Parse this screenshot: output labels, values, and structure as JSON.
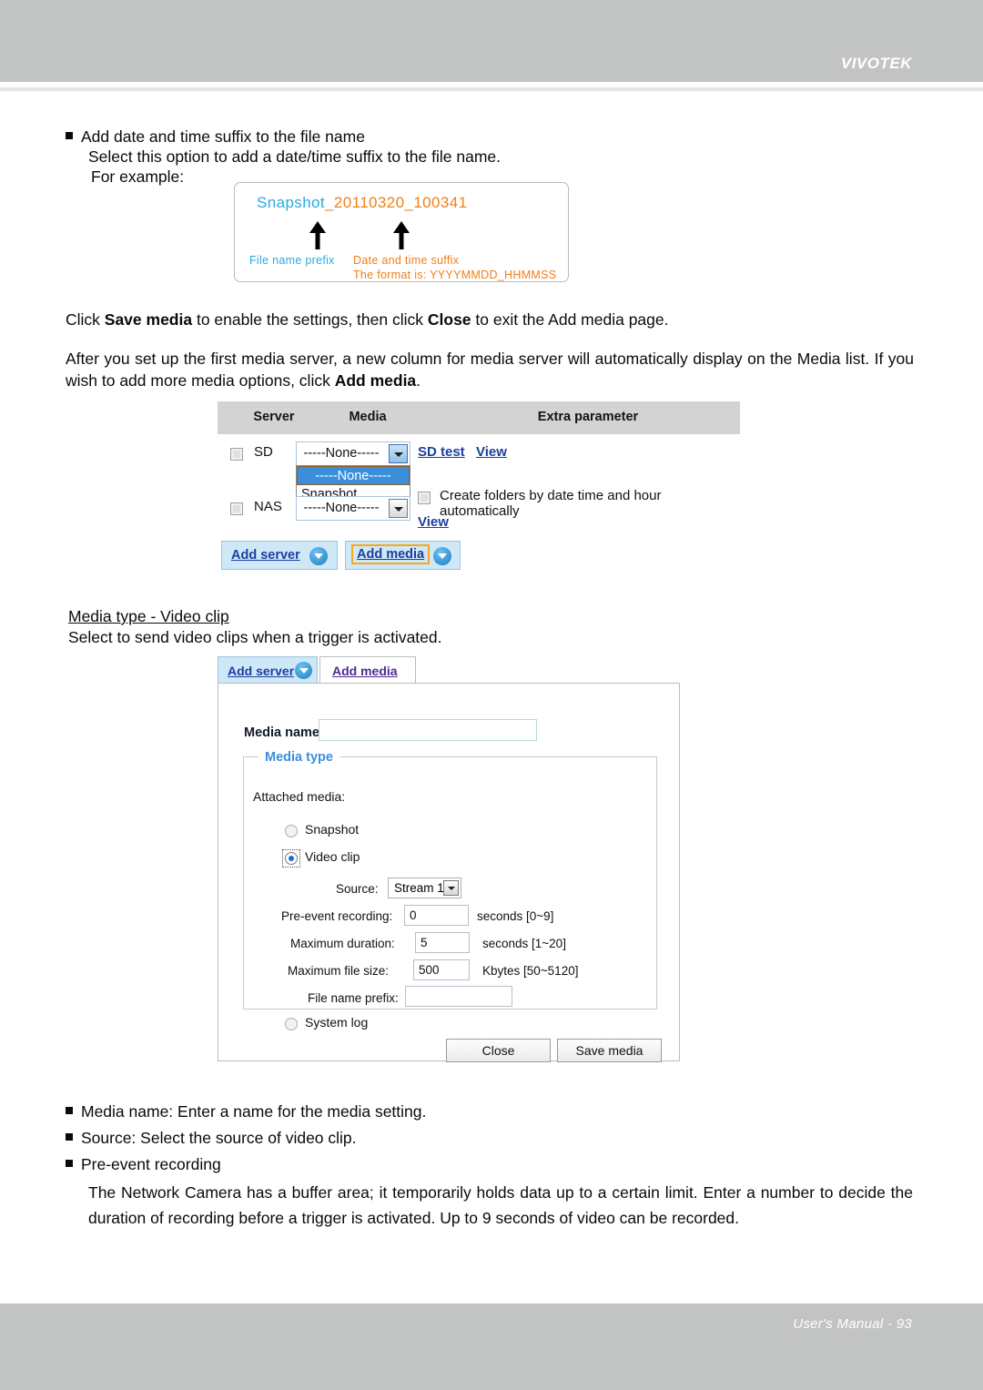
{
  "header": {
    "brand": "VIVOTEK"
  },
  "footer": {
    "text": "User's Manual - 93"
  },
  "section_suffix": {
    "bullet_title": "Add date and time suffix to the file name",
    "line1": "Select this option to add a date/time suffix to the file name.",
    "line2": "For example:"
  },
  "snapshot_example": {
    "prefix": "Snapshot",
    "suffix": "_20110320_100341",
    "label_prefix": "File name prefix",
    "label_suffix": "Date and time suffix",
    "label_format": "The format is: YYYYMMDD_HHMMSS",
    "color_blue": "#2aa9e0",
    "color_orange": "#f07f18"
  },
  "para_save": {
    "a": "Click ",
    "b1": "Save media",
    "c": " to enable the settings, then click ",
    "b2": "Close",
    "d": " to exit the Add media page."
  },
  "para_after": {
    "a": "After you set up the first media server, a new column for media server will automatically display on the Media list. If you wish to add more media options, click ",
    "b": "Add media",
    "c": "."
  },
  "media_list": {
    "columns": [
      "Server",
      "Media",
      "Extra parameter"
    ],
    "rows": [
      {
        "name": "SD",
        "checked": false,
        "media_value": "-----None-----",
        "links": [
          "SD test",
          "View"
        ],
        "extra_checkbox": "Create folders by date time and hour automatically",
        "extra_checked": false
      },
      {
        "name": "NAS",
        "checked": false,
        "media_value": "-----None-----",
        "links": [
          "View"
        ]
      }
    ],
    "dropdown_options": [
      "-----None-----",
      "Snapshot"
    ],
    "dropdown_selected": "-----None-----",
    "buttons": [
      {
        "label": "Add server",
        "highlighted": false
      },
      {
        "label": "Add media",
        "highlighted": true
      }
    ]
  },
  "section_videoclip": {
    "heading": "Media type - Video clip",
    "desc": "Select to send video clips when a trigger is activated."
  },
  "dialog": {
    "tabs": [
      {
        "label": "Add server",
        "active": false
      },
      {
        "label": "Add media",
        "active": true
      }
    ],
    "media_name_label": "Media name:",
    "media_name_value": "",
    "fieldset_legend": "Media type",
    "attached_media_label": "Attached media:",
    "options": [
      {
        "label": "Snapshot",
        "selected": false
      },
      {
        "label": "Video clip",
        "selected": true
      },
      {
        "label": "System log",
        "selected": false
      }
    ],
    "fields": [
      {
        "label": "Source:",
        "type": "select",
        "value": "Stream 1",
        "unit": ""
      },
      {
        "label": "Pre-event recording:",
        "type": "text",
        "value": "0",
        "unit": "seconds [0~9]"
      },
      {
        "label": "Maximum duration:",
        "type": "text",
        "value": "5",
        "unit": "seconds [1~20]"
      },
      {
        "label": "Maximum file size:",
        "type": "text",
        "value": "500",
        "unit": "Kbytes [50~5120]"
      },
      {
        "label": "File name prefix:",
        "type": "text",
        "value": "",
        "unit": ""
      }
    ],
    "buttons": [
      {
        "label": "Close"
      },
      {
        "label": "Save media"
      }
    ]
  },
  "notes": {
    "b1": "Media name: Enter a name for the media setting.",
    "b2": "Source: Select the source of video clip.",
    "b3": "Pre-event recording",
    "para": "The Network Camera has a buffer area; it temporarily holds data up to a certain limit. Enter a number to decide the duration of recording before a trigger is activated. Up to 9 seconds of video can be recorded."
  }
}
